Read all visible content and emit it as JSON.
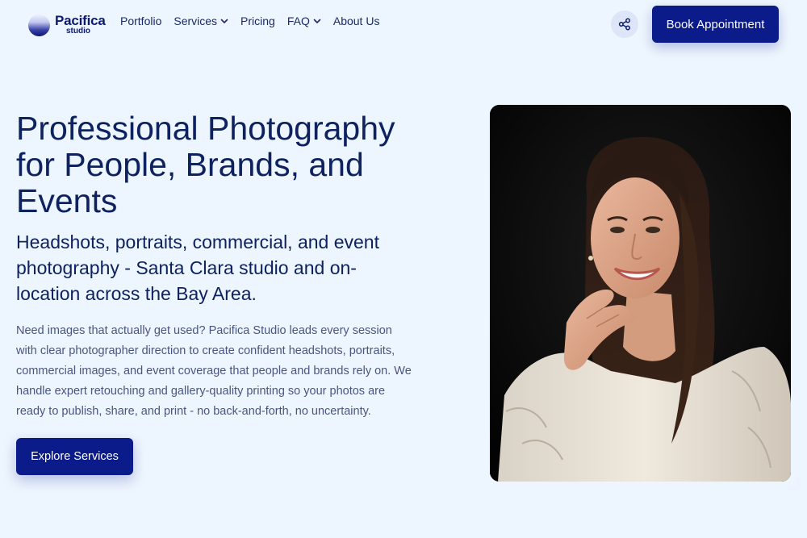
{
  "brand": {
    "name": "Pacifica",
    "sub": "studio"
  },
  "nav": {
    "items": [
      {
        "label": "Portfolio",
        "dropdown": false
      },
      {
        "label": "Services",
        "dropdown": true
      },
      {
        "label": "Pricing",
        "dropdown": false
      },
      {
        "label": "FAQ",
        "dropdown": true
      },
      {
        "label": "About Us",
        "dropdown": false
      }
    ]
  },
  "header": {
    "book_label": "Book Appointment"
  },
  "hero": {
    "title": "Professional Photography for People, Brands, and Events",
    "subtitle": "Headshots, portraits, commercial, and event photography - Santa Clara studio and on-location across the Bay Area.",
    "body": "Need images that actually get used? Pacifica Studio leads every session with clear photographer direction to create confident headshots, portraits, commercial images, and event coverage that people and brands rely on. We handle expert retouching and gallery-quality printing so your photos are ready to publish, share, and print - no back-and-forth, no uncertainty.",
    "cta_label": "Explore Services"
  },
  "colors": {
    "background": "#edf5fe",
    "primary": "#0b1b8a",
    "heading": "#0f2260",
    "body_text": "#4a5680"
  },
  "icons": {
    "share": "share-icon",
    "dropdown": "chevron-down-icon",
    "logo": "logo-mark-icon"
  }
}
